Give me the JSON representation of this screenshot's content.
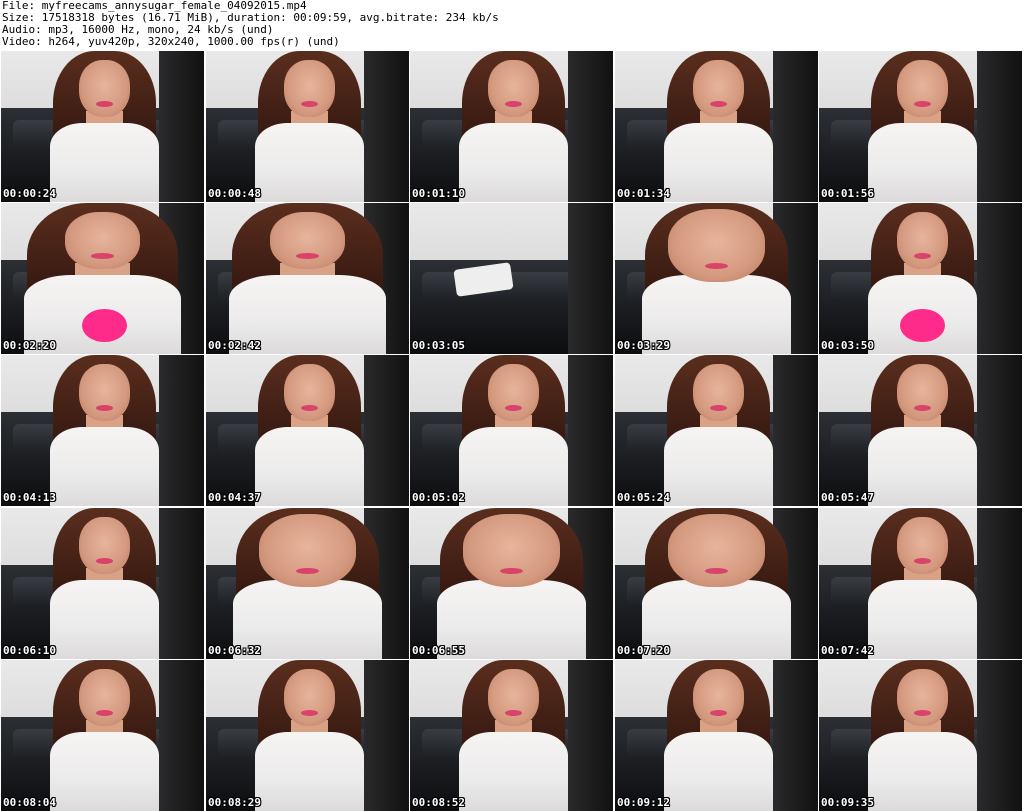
{
  "header": {
    "file": "File: myfreecams_annysugar_female_04092015.mp4",
    "size": "Size: 17518318 bytes (16.71 MiB), duration: 00:09:59, avg.bitrate: 234 kb/s",
    "audio": "Audio: mp3, 16000 Hz, mono, 24 kb/s (und)",
    "video": "Video: h264, yuv420p, 320x240, 1000.00 fps(r) (und)"
  },
  "thumbnails": [
    {
      "timestamp": "00:00:24"
    },
    {
      "timestamp": "00:00:48"
    },
    {
      "timestamp": "00:01:10"
    },
    {
      "timestamp": "00:01:34"
    },
    {
      "timestamp": "00:01:56"
    },
    {
      "timestamp": "00:02:20"
    },
    {
      "timestamp": "00:02:42"
    },
    {
      "timestamp": "00:03:05"
    },
    {
      "timestamp": "00:03:29"
    },
    {
      "timestamp": "00:03:50"
    },
    {
      "timestamp": "00:04:13"
    },
    {
      "timestamp": "00:04:37"
    },
    {
      "timestamp": "00:05:02"
    },
    {
      "timestamp": "00:05:24"
    },
    {
      "timestamp": "00:05:47"
    },
    {
      "timestamp": "00:06:10"
    },
    {
      "timestamp": "00:06:32"
    },
    {
      "timestamp": "00:06:55"
    },
    {
      "timestamp": "00:07:20"
    },
    {
      "timestamp": "00:07:42"
    },
    {
      "timestamp": "00:08:04"
    },
    {
      "timestamp": "00:08:29"
    },
    {
      "timestamp": "00:08:52"
    },
    {
      "timestamp": "00:09:12"
    },
    {
      "timestamp": "00:09:35"
    }
  ]
}
